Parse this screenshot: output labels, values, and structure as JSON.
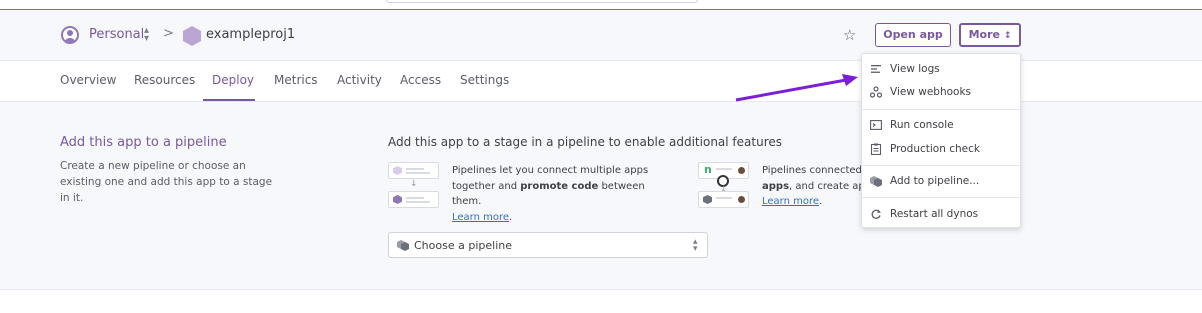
{
  "header": {
    "team": "Personal",
    "breadcrumb_separator": ">",
    "app_name": "exampleproj1",
    "open_app_label": "Open app",
    "more_label": "More",
    "more_caret": "⌃⌄",
    "star": "☆"
  },
  "tabs": [
    {
      "label": "Overview"
    },
    {
      "label": "Resources"
    },
    {
      "label": "Deploy",
      "active": true
    },
    {
      "label": "Metrics"
    },
    {
      "label": "Activity"
    },
    {
      "label": "Access"
    },
    {
      "label": "Settings"
    }
  ],
  "pipeline": {
    "left_heading": "Add this app to a pipeline",
    "left_description": "Create a new pipeline or choose an existing one and add this app to a stage in it.",
    "right_heading": "Add this app to a stage in a pipeline to enable additional features",
    "feature1_text_a": "Pipelines let you connect multiple apps together and ",
    "feature1_bold": "promote code",
    "feature1_text_b": " between them.",
    "feature1_link": "Learn more",
    "feature2_text_a": "Pipelines connected",
    "feature2_bold": "apps",
    "feature2_text_b": ", and create app",
    "feature2_link": "Learn more",
    "select_label": "Choose a pipeline"
  },
  "more_menu": {
    "items": [
      {
        "label": "View logs",
        "icon": "logs-icon"
      },
      {
        "label": "View webhooks",
        "icon": "webhooks-icon"
      },
      {
        "label": "Run console",
        "icon": "console-icon"
      },
      {
        "label": "Production check",
        "icon": "checklist-icon"
      },
      {
        "label": "Add to pipeline...",
        "icon": "pipeline-icon"
      },
      {
        "label": "Restart all dynos",
        "icon": "restart-icon"
      }
    ]
  },
  "colors": {
    "brand_purple": "#79589f",
    "annotation_arrow": "#7a1fd6",
    "link_blue": "#2f72c4"
  }
}
